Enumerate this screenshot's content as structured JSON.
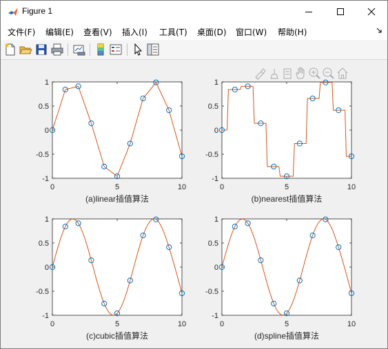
{
  "window": {
    "title": "Figure 1"
  },
  "menu": [
    {
      "label": "文件(F)"
    },
    {
      "label": "编辑(E)"
    },
    {
      "label": "查看(V)"
    },
    {
      "label": "插入(I)"
    },
    {
      "label": "工具(T)"
    },
    {
      "label": "桌面(D)"
    },
    {
      "label": "窗口(W)"
    },
    {
      "label": "帮助(H)"
    }
  ],
  "toolbar_icons": [
    "new-figure-icon",
    "open-file-icon",
    "save-icon",
    "print-icon",
    "link-plot-icon",
    "colorbar-icon",
    "legend-icon",
    "pointer-icon",
    "property-inspector-icon"
  ],
  "axes_toolbar_icons": [
    "brush-icon",
    "data-tips-icon",
    "export-icon",
    "pan-icon",
    "zoom-in-icon",
    "zoom-out-icon",
    "home-icon"
  ],
  "colors": {
    "line": "#D95319",
    "marker": "#0072BD"
  },
  "chart_data": [
    {
      "type": "line",
      "title": "",
      "xlabel": "(a)linear插值算法",
      "ylabel": "",
      "xlim": [
        0,
        10
      ],
      "ylim": [
        -1,
        1
      ],
      "xticks": [
        0,
        5,
        10
      ],
      "yticks": [
        1,
        0.5,
        0,
        -0.5,
        -1
      ],
      "ytick_labels": [
        "1",
        "0.5",
        "0",
        "-0.5",
        "-1"
      ],
      "xtick_labels": [
        "0",
        "5",
        "10"
      ],
      "method": "linear",
      "samples": {
        "x": [
          0,
          1,
          2,
          3,
          4,
          5,
          6,
          7,
          8,
          9,
          10
        ],
        "y": [
          0,
          0.841,
          0.909,
          0.141,
          -0.757,
          -0.959,
          -0.279,
          0.657,
          0.989,
          0.412,
          -0.544
        ]
      }
    },
    {
      "type": "line",
      "title": "",
      "xlabel": "(b)nearest插值算法",
      "ylabel": "",
      "xlim": [
        0,
        10
      ],
      "ylim": [
        -1,
        1
      ],
      "xticks": [
        0,
        5,
        10
      ],
      "yticks": [
        1,
        0.5,
        0,
        -0.5,
        -1
      ],
      "ytick_labels": [
        "1",
        "0.5",
        "0",
        "-0.5",
        "-1"
      ],
      "xtick_labels": [
        "0",
        "5",
        "10"
      ],
      "method": "nearest",
      "samples": {
        "x": [
          0,
          1,
          2,
          3,
          4,
          5,
          6,
          7,
          8,
          9,
          10
        ],
        "y": [
          0,
          0.841,
          0.909,
          0.141,
          -0.757,
          -0.959,
          -0.279,
          0.657,
          0.989,
          0.412,
          -0.544
        ]
      }
    },
    {
      "type": "line",
      "title": "",
      "xlabel": "(c)cubic插值算法",
      "ylabel": "",
      "xlim": [
        0,
        10
      ],
      "ylim": [
        -1,
        1
      ],
      "xticks": [
        0,
        5,
        10
      ],
      "yticks": [
        1,
        0.5,
        0,
        -0.5,
        -1
      ],
      "ytick_labels": [
        "1",
        "0.5",
        "0",
        "-0.5",
        "-1"
      ],
      "xtick_labels": [
        "0",
        "5",
        "10"
      ],
      "method": "smooth",
      "samples": {
        "x": [
          0,
          1,
          2,
          3,
          4,
          5,
          6,
          7,
          8,
          9,
          10
        ],
        "y": [
          0,
          0.841,
          0.909,
          0.141,
          -0.757,
          -0.959,
          -0.279,
          0.657,
          0.989,
          0.412,
          -0.544
        ]
      }
    },
    {
      "type": "line",
      "title": "",
      "xlabel": "(d)spline插值算法",
      "ylabel": "",
      "xlim": [
        0,
        10
      ],
      "ylim": [
        -1,
        1
      ],
      "xticks": [
        0,
        5,
        10
      ],
      "yticks": [
        1,
        0.5,
        0,
        -0.5,
        -1
      ],
      "ytick_labels": [
        "1",
        "0.5",
        "0",
        "-0.5",
        "-1"
      ],
      "xtick_labels": [
        "0",
        "5",
        "10"
      ],
      "method": "smooth",
      "samples": {
        "x": [
          0,
          1,
          2,
          3,
          4,
          5,
          6,
          7,
          8,
          9,
          10
        ],
        "y": [
          0,
          0.841,
          0.909,
          0.141,
          -0.757,
          -0.959,
          -0.279,
          0.657,
          0.989,
          0.412,
          -0.544
        ]
      }
    }
  ]
}
